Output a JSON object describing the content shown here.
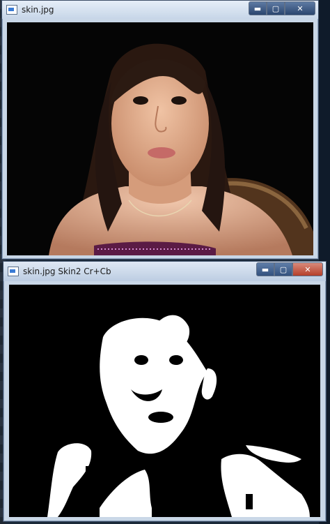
{
  "windows": [
    {
      "title": "skin.jpg"
    },
    {
      "title": "skin.jpg Skin2 Cr+Cb"
    }
  ],
  "controls": {
    "minimize": "▬",
    "maximize": "▢",
    "close": "✕"
  },
  "colors": {
    "titlebar_light": "#e6eef8",
    "close_red": "#c8503a",
    "mask_white": "#ffffff",
    "mask_black": "#000000"
  }
}
